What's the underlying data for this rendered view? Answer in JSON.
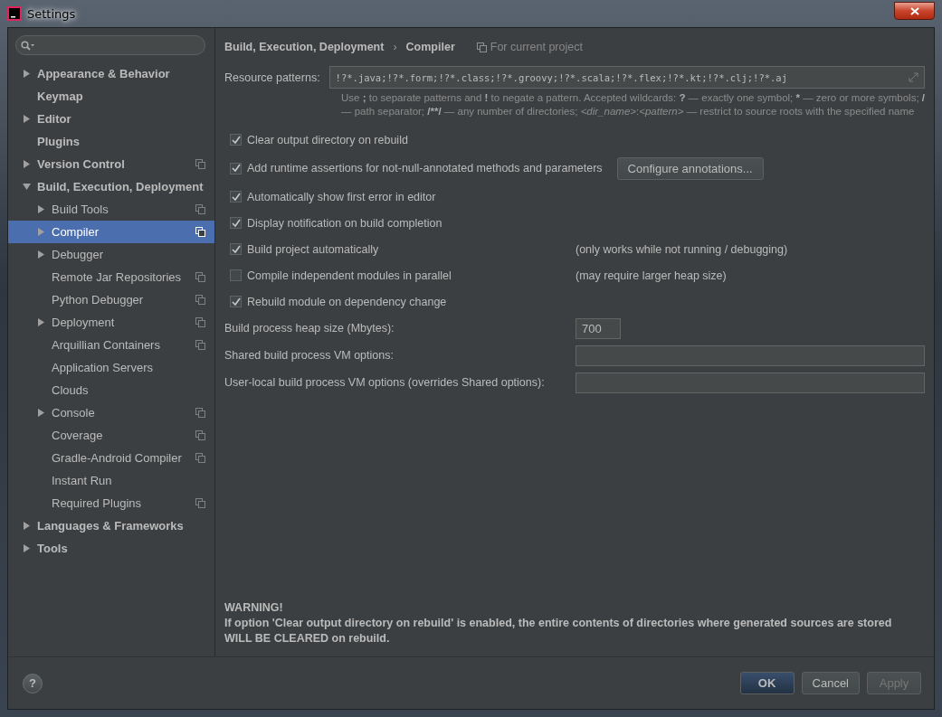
{
  "window": {
    "title": "Settings"
  },
  "sidebar": {
    "items": [
      {
        "label": "Appearance & Behavior",
        "expanded": false,
        "selected": false,
        "project_scoped": false
      },
      {
        "label": "Keymap",
        "selected": false,
        "project_scoped": false
      },
      {
        "label": "Editor",
        "expanded": false,
        "selected": false,
        "project_scoped": false
      },
      {
        "label": "Plugins",
        "selected": false,
        "project_scoped": false
      },
      {
        "label": "Version Control",
        "expanded": false,
        "selected": false,
        "project_scoped": true
      },
      {
        "label": "Build, Execution, Deployment",
        "expanded": true,
        "selected": false,
        "project_scoped": false,
        "children": [
          {
            "label": "Build Tools",
            "expanded": false,
            "selected": false,
            "project_scoped": true
          },
          {
            "label": "Compiler",
            "expanded": false,
            "selected": true,
            "project_scoped": true
          },
          {
            "label": "Debugger",
            "expanded": false,
            "selected": false,
            "project_scoped": false
          },
          {
            "label": "Remote Jar Repositories",
            "selected": false,
            "project_scoped": true
          },
          {
            "label": "Python Debugger",
            "selected": false,
            "project_scoped": true
          },
          {
            "label": "Deployment",
            "expanded": false,
            "selected": false,
            "project_scoped": true
          },
          {
            "label": "Arquillian Containers",
            "selected": false,
            "project_scoped": true
          },
          {
            "label": "Application Servers",
            "selected": false,
            "project_scoped": false
          },
          {
            "label": "Clouds",
            "selected": false,
            "project_scoped": false
          },
          {
            "label": "Console",
            "expanded": false,
            "selected": false,
            "project_scoped": true
          },
          {
            "label": "Coverage",
            "selected": false,
            "project_scoped": true
          },
          {
            "label": "Gradle-Android Compiler",
            "selected": false,
            "project_scoped": true
          },
          {
            "label": "Instant Run",
            "selected": false,
            "project_scoped": false
          },
          {
            "label": "Required Plugins",
            "selected": false,
            "project_scoped": true
          }
        ]
      },
      {
        "label": "Languages & Frameworks",
        "expanded": false,
        "selected": false,
        "project_scoped": false
      },
      {
        "label": "Tools",
        "expanded": false,
        "selected": false,
        "project_scoped": false
      }
    ]
  },
  "breadcrumb": {
    "items": [
      "Build, Execution, Deployment",
      "Compiler"
    ],
    "separator": "›",
    "scope": "For current project"
  },
  "resource_patterns": {
    "label": "Resource patterns:",
    "value": "!?*.java;!?*.form;!?*.class;!?*.groovy;!?*.scala;!?*.flex;!?*.kt;!?*.clj;!?*.aj",
    "hint": [
      {
        "kind": "plain",
        "text": "Use "
      },
      {
        "kind": "bold",
        "text": ";"
      },
      {
        "kind": "plain",
        "text": " to separate patterns and "
      },
      {
        "kind": "bold",
        "text": "!"
      },
      {
        "kind": "plain",
        "text": " to negate a pattern. Accepted wildcards: "
      },
      {
        "kind": "bold",
        "text": "?"
      },
      {
        "kind": "plain",
        "text": " — exactly one symbol; "
      },
      {
        "kind": "bold",
        "text": "*"
      },
      {
        "kind": "plain",
        "text": " — zero or more symbols; "
      },
      {
        "kind": "bold",
        "text": "/"
      },
      {
        "kind": "plain",
        "text": " — path separator; "
      },
      {
        "kind": "bold",
        "text": "/**/"
      },
      {
        "kind": "plain",
        "text": " — any number of directories; "
      },
      {
        "kind": "italic",
        "text": "<dir_name>"
      },
      {
        "kind": "plain",
        "text": ":"
      },
      {
        "kind": "italic",
        "text": "<pattern>"
      },
      {
        "kind": "plain",
        "text": " — restrict to source roots with the specified name"
      }
    ]
  },
  "options": [
    {
      "label": "Clear output directory on rebuild",
      "checked": true
    },
    {
      "label": "Add runtime assertions for not-null-annotated methods and parameters",
      "checked": true,
      "button": "Configure annotations..."
    },
    {
      "label": "Automatically show first error in editor",
      "checked": true
    },
    {
      "label": "Display notification on build completion",
      "checked": true
    },
    {
      "label": "Build project automatically",
      "checked": true,
      "note": "(only works while not running / debugging)"
    },
    {
      "label": "Compile independent modules in parallel",
      "checked": false,
      "note": "(may require larger heap size)"
    },
    {
      "label": "Rebuild module on dependency change",
      "checked": true
    }
  ],
  "fields": [
    {
      "label": "Build process heap size (Mbytes):",
      "value": "700",
      "kind": "short"
    },
    {
      "label": "Shared build process VM options:",
      "kind": "wide"
    },
    {
      "label": "User-local build process VM options (overrides Shared options):",
      "kind": "wide"
    }
  ],
  "warning": {
    "title": "WARNING!",
    "lines": [
      "If option 'Clear output directory on rebuild' is enabled, the entire contents of directories where generated sources are stored",
      "WILL BE CLEARED on rebuild."
    ]
  },
  "footer": {
    "help": "?",
    "buttons": [
      {
        "label": "OK",
        "kind": "default",
        "disabled": false
      },
      {
        "label": "Cancel",
        "kind": "normal",
        "disabled": false
      },
      {
        "label": "Apply",
        "kind": "normal",
        "disabled": true
      }
    ]
  }
}
